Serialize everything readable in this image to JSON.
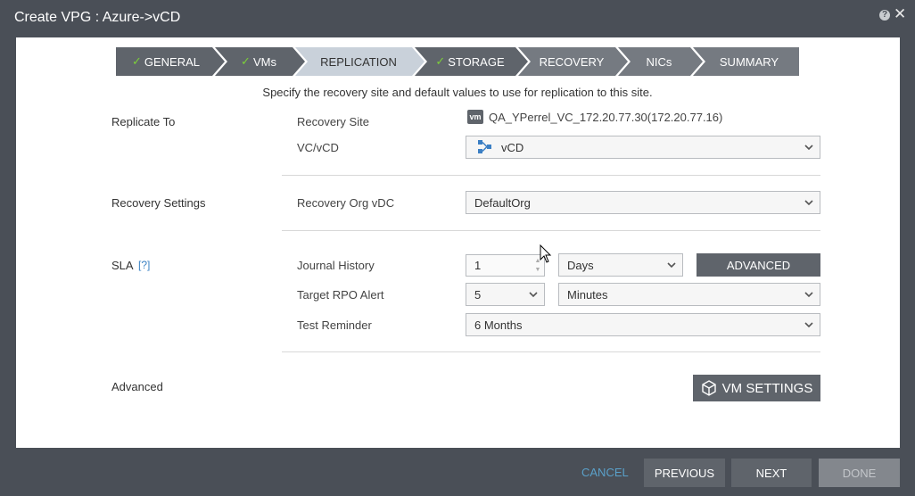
{
  "window": {
    "title": "Create VPG : Azure->vCD"
  },
  "wizard": {
    "steps": [
      {
        "label": "GENERAL",
        "completed": true
      },
      {
        "label": "VMs",
        "completed": true
      },
      {
        "label": "REPLICATION",
        "completed": false,
        "active": true
      },
      {
        "label": "STORAGE",
        "completed": true
      },
      {
        "label": "RECOVERY",
        "completed": false
      },
      {
        "label": "NICs",
        "completed": false
      },
      {
        "label": "SUMMARY",
        "completed": false
      }
    ]
  },
  "subtitle": "Specify the recovery site and default values to use for replication to this site.",
  "replicate_to": {
    "section_label": "Replicate To",
    "recovery_site_label": "Recovery Site",
    "recovery_site_badge": "vm",
    "recovery_site_value": "QA_YPerrel_VC_172.20.77.30(172.20.77.16)",
    "vc_label": "VC/vCD",
    "vc_value": "vCD"
  },
  "recovery_settings": {
    "section_label": "Recovery Settings",
    "org_vdc_label": "Recovery Org vDC",
    "org_vdc_value": "DefaultOrg"
  },
  "sla": {
    "section_label": "SLA",
    "help_link": "[?]",
    "journal_history_label": "Journal History",
    "journal_history_value": "1",
    "journal_history_unit": "Days",
    "advanced_button": "ADVANCED",
    "rpo_label": "Target RPO Alert",
    "rpo_value": "5",
    "rpo_unit": "Minutes",
    "test_reminder_label": "Test Reminder",
    "test_reminder_value": "6 Months"
  },
  "advanced": {
    "section_label": "Advanced",
    "vm_settings_button": "VM SETTINGS"
  },
  "footer": {
    "cancel": "CANCEL",
    "previous": "PREVIOUS",
    "next": "NEXT",
    "done": "DONE"
  },
  "colors": {
    "step_completed": "#5f646b",
    "step_active": "#c9d1da",
    "step_inactive": "#757a81",
    "check": "#7ccf3a",
    "button_dark": "#5f646b",
    "button_disabled": "#83878d",
    "cancel_link": "#5aa0c9"
  }
}
